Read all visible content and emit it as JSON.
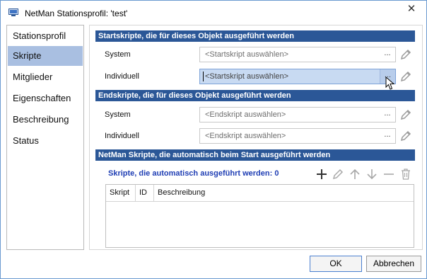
{
  "window": {
    "title": "NetMan Stationsprofil: 'test'",
    "close_symbol": "✕"
  },
  "nav": {
    "items": [
      {
        "label": "Stationsprofil",
        "selected": false
      },
      {
        "label": "Skripte",
        "selected": true
      },
      {
        "label": "Mitglieder",
        "selected": false
      },
      {
        "label": "Eigenschaften",
        "selected": false
      },
      {
        "label": "Beschreibung",
        "selected": false
      },
      {
        "label": "Status",
        "selected": false
      }
    ]
  },
  "startskripte": {
    "header": "Startskripte, die für dieses Objekt ausgeführt werden",
    "system_label": "System",
    "system_placeholder": "<Startskript auswählen>",
    "individuell_label": "Individuell",
    "individuell_placeholder": "<Startskript auswählen>"
  },
  "endskripte": {
    "header": "Endskripte, die für dieses Objekt ausgeführt werden",
    "system_label": "System",
    "system_placeholder": "<Endskript auswählen>",
    "individuell_label": "Individuell",
    "individuell_placeholder": "<Endskript auswählen>"
  },
  "netman_skripte": {
    "header": "NetMan Skripte, die automatisch beim Start ausgeführt werden",
    "subheading": "Skripte, die automatisch ausgeführt werden: 0",
    "toolbar_icons": [
      "plus-icon",
      "pencil-icon",
      "arrow-up-icon",
      "arrow-down-icon",
      "minus-icon",
      "trash-icon"
    ],
    "columns": [
      "Skript",
      "ID",
      "Beschreibung"
    ]
  },
  "browse_label": "...",
  "footer": {
    "ok_label": "OK",
    "cancel_label": "Abbrechen"
  },
  "colors": {
    "section_header": "#2b5797",
    "nav_selected": "#a9bfe1",
    "combo_active": "#c8daf2",
    "subheading": "#1f3eb4"
  }
}
